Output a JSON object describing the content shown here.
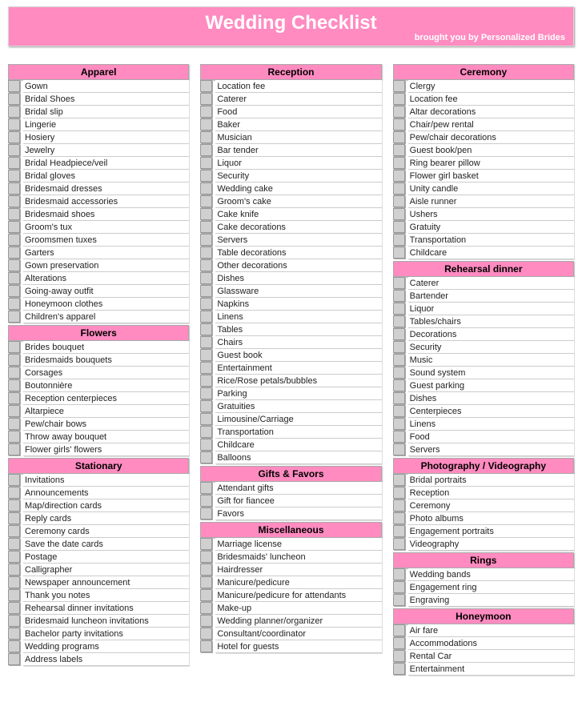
{
  "banner": {
    "title": "Wedding Checklist",
    "subtitle": "brought you by Personalized Brides"
  },
  "columns": [
    [
      {
        "title": "Apparel",
        "items": [
          "Gown",
          "Bridal Shoes",
          "Bridal slip",
          "Lingerie",
          "Hosiery",
          "Jewelry",
          "Bridal Headpiece/veil",
          "Bridal gloves",
          "Bridesmaid dresses",
          "Bridesmaid accessories",
          "Bridesmaid shoes",
          "Groom's tux",
          "Groomsmen tuxes",
          "Garters",
          "Gown preservation",
          "Alterations",
          "Going-away outfit",
          "Honeymoon clothes",
          "Children's apparel"
        ]
      },
      {
        "title": "Flowers",
        "items": [
          "Brides bouquet",
          "Bridesmaids bouquets",
          "Corsages",
          "Boutonnière",
          "Reception centerpieces",
          "Altarpiece",
          "Pew/chair bows",
          "Throw away bouquet",
          "Flower girls' flowers"
        ]
      },
      {
        "title": "Stationary",
        "items": [
          "Invitations",
          "Announcements",
          "Map/direction cards",
          "Reply cards",
          "Ceremony cards",
          "Save the date cards",
          "Postage",
          "Calligrapher",
          "Newspaper announcement",
          "Thank you notes",
          "Rehearsal dinner invitations",
          "Bridesmaid luncheon invitations",
          "Bachelor party invitations",
          "Wedding programs",
          "Address labels"
        ]
      }
    ],
    [
      {
        "title": "Reception",
        "items": [
          "Location fee",
          "Caterer",
          "Food",
          "Baker",
          "Musician",
          "Bar tender",
          "Liquor",
          "Security",
          "Wedding cake",
          "Groom's cake",
          "Cake knife",
          "Cake decorations",
          "Servers",
          "Table decorations",
          "Other decorations",
          "Dishes",
          "Glassware",
          "Napkins",
          "Linens",
          "Tables",
          "Chairs",
          "Guest book",
          "Entertainment",
          "Rice/Rose petals/bubbles",
          "Parking",
          "Gratuities",
          "Limousine/Carriage",
          "Transportation",
          "Childcare",
          "Balloons"
        ]
      },
      {
        "title": "Gifts & Favors",
        "items": [
          "Attendant gifts",
          "Gift for fiancee",
          "Favors"
        ]
      },
      {
        "title": "Miscellaneous",
        "items": [
          "Marriage license",
          "Bridesmaids' luncheon",
          "Hairdresser",
          "Manicure/pedicure",
          "Manicure/pedicure for attendants",
          "Make-up",
          "Wedding planner/organizer",
          "Consultant/coordinator",
          "Hotel for guests"
        ]
      }
    ],
    [
      {
        "title": "Ceremony",
        "items": [
          "Clergy",
          "Location fee",
          "Altar decorations",
          "Chair/pew rental",
          "Pew/chair decorations",
          "Guest book/pen",
          "Ring bearer pillow",
          "Flower girl basket",
          "Unity candle",
          "Aisle runner",
          "Ushers",
          "Gratuity",
          "Transportation",
          "Childcare"
        ]
      },
      {
        "title": "Rehearsal dinner",
        "items": [
          "Caterer",
          "Bartender",
          "Liquor",
          "Tables/chairs",
          "Decorations",
          "Security",
          "Music",
          "Sound system",
          "Guest parking",
          "Dishes",
          "Centerpieces",
          "Linens",
          "Food",
          "Servers"
        ]
      },
      {
        "title": "Photography / Videography",
        "items": [
          "Bridal portraits",
          "Reception",
          "Ceremony",
          "Photo albums",
          "Engagement portraits",
          "Videography"
        ]
      },
      {
        "title": "Rings",
        "items": [
          "Wedding bands",
          "Engagement ring",
          "Engraving"
        ]
      },
      {
        "title": "Honeymoon",
        "items": [
          "Air fare",
          "Accommodations",
          "Rental Car",
          "Entertainment"
        ]
      }
    ]
  ]
}
